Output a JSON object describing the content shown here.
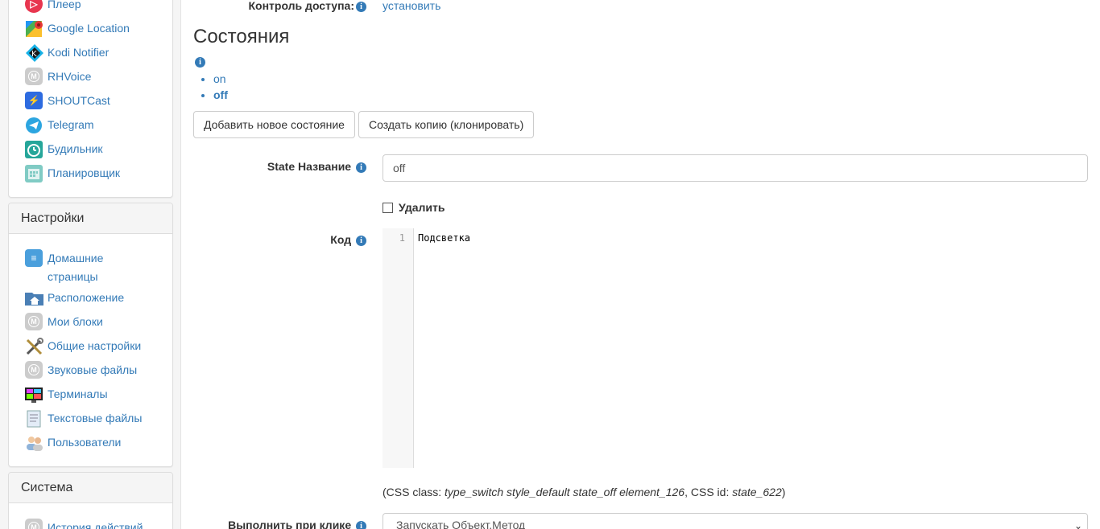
{
  "sidebar": {
    "top_items": [
      {
        "label": "Плеер",
        "icon": "player-icon"
      },
      {
        "label": "Google Location",
        "icon": "google-maps-icon"
      },
      {
        "label": "Kodi Notifier",
        "icon": "kodi-icon"
      },
      {
        "label": "RHVoice",
        "icon": "module-icon"
      },
      {
        "label": "SHOUTCast",
        "icon": "shoutcast-icon"
      },
      {
        "label": "Telegram",
        "icon": "telegram-icon"
      },
      {
        "label": "Будильник",
        "icon": "alarm-clock-icon"
      },
      {
        "label": "Планировщик",
        "icon": "calendar-icon"
      }
    ],
    "settings": {
      "title": "Настройки",
      "items": [
        {
          "label": "Домашние страницы",
          "icon": "document-icon"
        },
        {
          "label": "Расположение",
          "icon": "folder-home-icon"
        },
        {
          "label": "Мои блоки",
          "icon": "module-icon"
        },
        {
          "label": "Общие настройки",
          "icon": "tools-icon"
        },
        {
          "label": "Звуковые файлы",
          "icon": "module-icon"
        },
        {
          "label": "Терминалы",
          "icon": "terminal-icon"
        },
        {
          "label": "Текстовые файлы",
          "icon": "text-file-icon"
        },
        {
          "label": "Пользователи",
          "icon": "users-icon"
        }
      ]
    },
    "system": {
      "title": "Система",
      "items": [
        {
          "label": "История действий",
          "icon": "module-icon"
        }
      ]
    }
  },
  "main": {
    "access_label": "Контроль доступа:",
    "access_link": "установить",
    "section_title": "Состояния",
    "states": [
      "on",
      "off"
    ],
    "add_state_button": "Добавить новое состояние",
    "clone_button": "Создать копию (клонировать)",
    "state_name_label": "State Название",
    "state_name_value": "off",
    "delete_label": "Удалить",
    "code_label": "Код",
    "code_line_number": "1",
    "code_text": "Подсветка",
    "css_note": {
      "prefix": "(CSS class: ",
      "classes": "type_switch style_default state_off element_126",
      "mid": ", CSS id: ",
      "id": "state_622",
      "suffix": ")"
    },
    "on_click_label": "Выполнить при клике",
    "on_click_value": "Запускать Объект.Метод"
  },
  "colors": {
    "link": "#337ab7",
    "sidebar_bg": "#f5f5f5"
  }
}
